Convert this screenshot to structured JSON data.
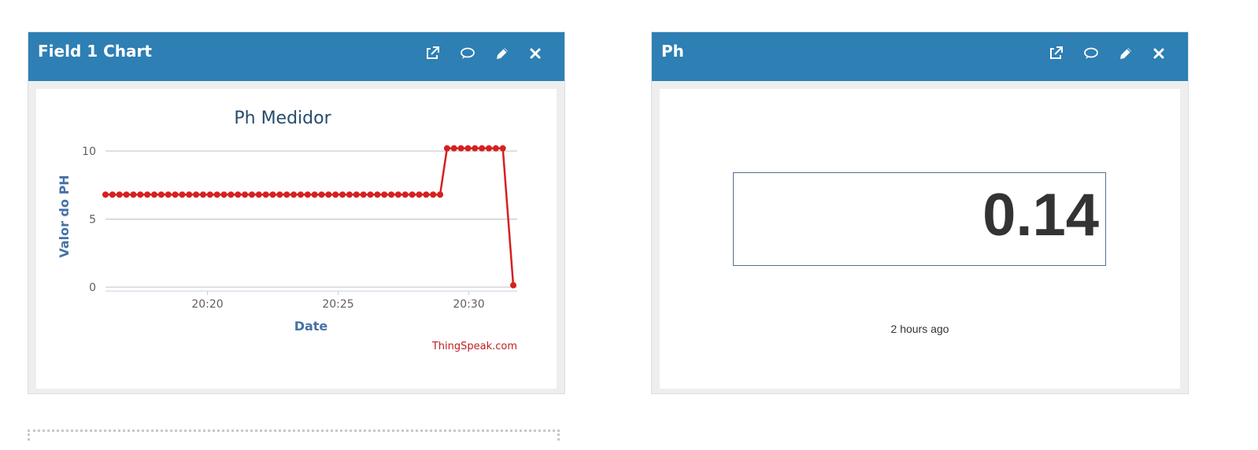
{
  "widgets": [
    {
      "title": "Field 1 Chart",
      "icons": [
        "external-link-icon",
        "comment-icon",
        "pencil-icon",
        "close-icon"
      ]
    },
    {
      "title": "Ph",
      "icons": [
        "external-link-icon",
        "comment-icon",
        "pencil-icon",
        "close-icon"
      ],
      "value": "0.14",
      "time_ago": "2 hours ago"
    }
  ],
  "chart_data": {
    "type": "line",
    "title": "Ph Medidor",
    "xlabel": "Date",
    "ylabel": "Valor do PH",
    "credit": "ThingSpeak.com",
    "x_ticks": [
      "20:20",
      "20:25",
      "20:30"
    ],
    "y_ticks": [
      0,
      5,
      10
    ],
    "ylim": [
      0,
      10.5
    ],
    "xlim": [
      "20:16:06",
      "20:31:42"
    ],
    "grid": true,
    "legend": "none",
    "color": "#d62020",
    "series": [
      {
        "x": [
          "20:16:06",
          "20:16:22",
          "20:16:38",
          "20:16:54",
          "20:17:10",
          "20:17:26",
          "20:17:42",
          "20:17:58",
          "20:18:14",
          "20:18:30",
          "20:18:46",
          "20:19:02",
          "20:19:18",
          "20:19:34",
          "20:19:50",
          "20:20:06",
          "20:20:22",
          "20:20:38",
          "20:20:54",
          "20:21:10",
          "20:21:26",
          "20:21:42",
          "20:21:58",
          "20:22:14",
          "20:22:30",
          "20:22:46",
          "20:23:02",
          "20:23:18",
          "20:23:34",
          "20:23:50",
          "20:24:06",
          "20:24:22",
          "20:24:38",
          "20:24:54",
          "20:25:10",
          "20:25:26",
          "20:25:42",
          "20:25:58",
          "20:26:14",
          "20:26:30",
          "20:26:46",
          "20:27:02",
          "20:27:18",
          "20:27:34",
          "20:27:50",
          "20:28:06",
          "20:28:22",
          "20:28:38",
          "20:28:54",
          "20:29:10",
          "20:29:26",
          "20:29:42",
          "20:29:58",
          "20:30:14",
          "20:30:30",
          "20:30:46",
          "20:31:02",
          "20:31:18",
          "20:31:42"
        ],
        "values": [
          6.8,
          6.8,
          6.8,
          6.8,
          6.8,
          6.8,
          6.8,
          6.8,
          6.8,
          6.8,
          6.8,
          6.8,
          6.8,
          6.8,
          6.8,
          6.8,
          6.8,
          6.8,
          6.8,
          6.8,
          6.8,
          6.8,
          6.8,
          6.8,
          6.8,
          6.8,
          6.8,
          6.8,
          6.8,
          6.8,
          6.8,
          6.8,
          6.8,
          6.8,
          6.8,
          6.8,
          6.8,
          6.8,
          6.8,
          6.8,
          6.8,
          6.8,
          6.8,
          6.8,
          6.8,
          6.8,
          6.8,
          6.8,
          6.8,
          10.2,
          10.2,
          10.2,
          10.2,
          10.2,
          10.2,
          10.2,
          10.2,
          10.2,
          0.14
        ]
      }
    ]
  }
}
